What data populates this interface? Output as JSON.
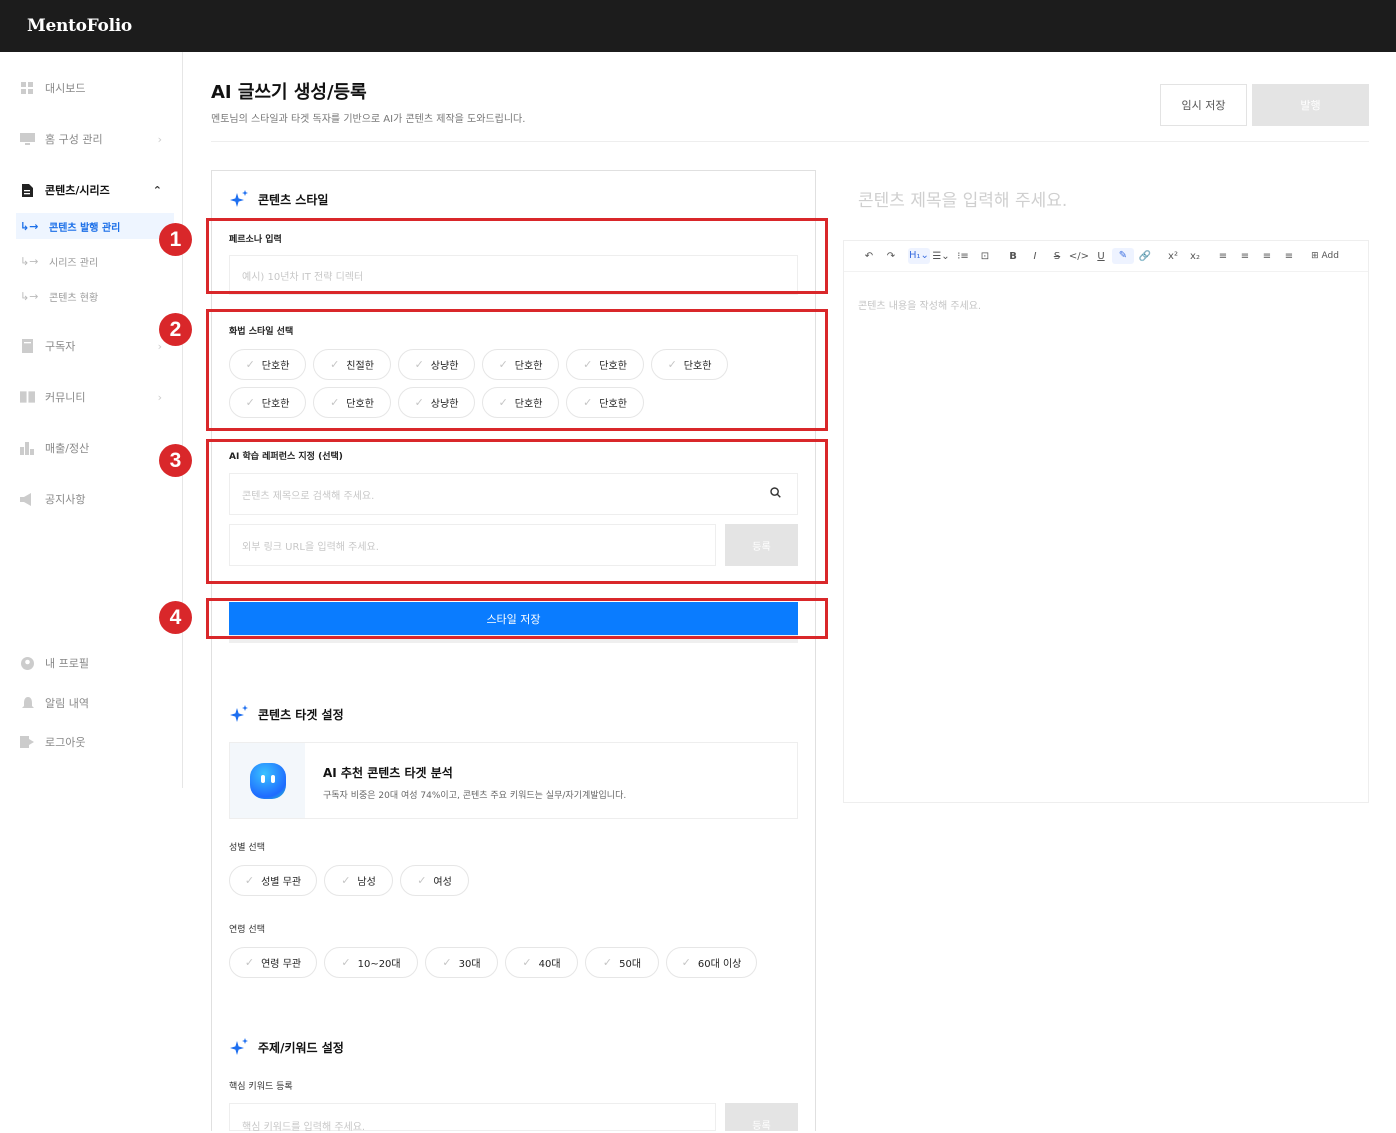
{
  "app": {
    "brand": "MentoFolio"
  },
  "sidebar": {
    "items": [
      {
        "label": "대시보드",
        "icon": "dashboard-icon",
        "chev": ""
      },
      {
        "label": "홈 구성 관리",
        "icon": "monitor-icon",
        "chev": "›"
      },
      {
        "label": "콘텐츠/시리즈",
        "icon": "document-icon",
        "chev": "⌃"
      },
      {
        "label": "구독자",
        "icon": "subscriber-icon",
        "chev": "›"
      },
      {
        "label": "커뮤니티",
        "icon": "book-icon",
        "chev": "›"
      },
      {
        "label": "매출/정산",
        "icon": "chart-icon",
        "chev": ""
      },
      {
        "label": "공지사항",
        "icon": "megaphone-icon",
        "chev": ""
      }
    ],
    "sub_items": [
      {
        "label": "콘텐츠 발행 관리"
      },
      {
        "label": "시리즈 관리"
      },
      {
        "label": "콘텐츠 현황"
      }
    ],
    "bottom_items": [
      {
        "label": "내 프로필",
        "icon": "profile-icon"
      },
      {
        "label": "알림 내역",
        "icon": "bell-icon"
      },
      {
        "label": "로그아웃",
        "icon": "logout-icon"
      }
    ]
  },
  "header": {
    "title": "AI 글쓰기 생성/등록",
    "description": "멘토님의 스타일과 타겟 독자를 기반으로 AI가 콘텐츠 제작을 도와드립니다.",
    "draft_label": "임시 저장",
    "publish_label": "발행"
  },
  "style_section": {
    "title": "콘텐츠 스타일",
    "persona_label": "페르소나 입력",
    "persona_placeholder": "예시) 10년차 IT 전략 디렉터",
    "tone_label": "화법 스타일 선택",
    "tones": [
      "단호한",
      "친절한",
      "상냥한",
      "단호한",
      "단호한",
      "단호한",
      "단호한",
      "단호한",
      "상냥한",
      "단호한",
      "단호한"
    ],
    "reference_label": "AI 학습 레퍼런스 지정 (선택)",
    "search_placeholder": "콘텐츠 제목으로 검색해 주세요.",
    "url_placeholder": "외부 링크 URL을 입력해 주세요.",
    "url_register_label": "등록",
    "save_label": "스타일 저장"
  },
  "target_section": {
    "title": "콘텐츠 타겟 설정",
    "ai_title": "AI 추천 콘텐츠 타겟 분석",
    "ai_desc": "구독자 비중은 20대 여성 74%이고, 콘텐츠 주요 키워드는 실무/자기계발입니다.",
    "gender_label": "성별 선택",
    "genders": [
      "성별 무관",
      "남성",
      "여성"
    ],
    "age_label": "연령 선택",
    "ages": [
      "연령 무관",
      "10~20대",
      "30대",
      "40대",
      "50대",
      "60대 이상"
    ]
  },
  "keyword_section": {
    "title": "주제/키워드 설정",
    "keyword_label": "핵심 키워드 등록",
    "keyword_placeholder": "핵심 키워드를 입력해 주세요.",
    "register_label": "등록"
  },
  "editor": {
    "title_placeholder": "콘텐츠 제목을 입력해 주세요.",
    "body_placeholder": "콘텐츠 내용을 작성해 주세요.",
    "toolbar": [
      "↶",
      "↷",
      "",
      "H₁⌄",
      "☰⌄",
      "⁝≡",
      "⊡",
      "",
      "B",
      "I",
      "S",
      "</>",
      "U",
      "✎",
      "🔗",
      "",
      "x²",
      "x₂",
      "",
      "≡",
      "≡",
      "≡",
      "≡",
      "",
      "⊞ Add"
    ]
  },
  "annotations": [
    "1",
    "2",
    "3",
    "4"
  ],
  "colors": {
    "accent": "#0a7cff",
    "marker": "#d9272a",
    "topbar": "#1c1c1c"
  }
}
